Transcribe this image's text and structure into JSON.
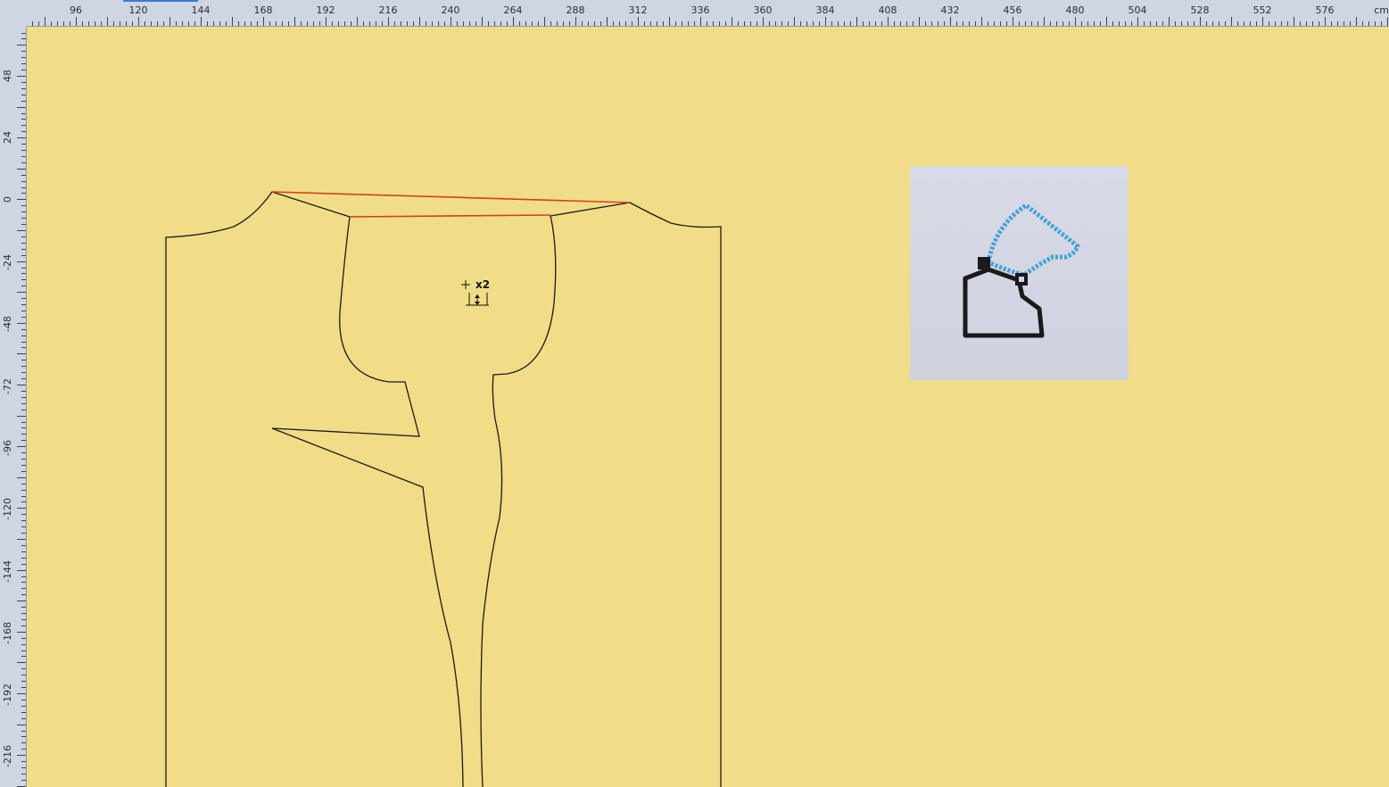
{
  "ruler": {
    "unit": "cm",
    "horizontal_labels": [
      "96",
      "120",
      "144",
      "168",
      "192",
      "216",
      "240",
      "264",
      "288",
      "312",
      "336",
      "360",
      "384",
      "408",
      "432",
      "456",
      "480",
      "504",
      "528",
      "552",
      "576"
    ],
    "vertical_labels": [
      "48",
      "24",
      "0",
      "-24",
      "-48",
      "-72",
      "-96",
      "-120",
      "-144",
      "-168",
      "-192",
      "-216"
    ]
  },
  "cursor": {
    "multiplier": "x2"
  },
  "canvas": {
    "background": "#f1dd87",
    "outline_color": "#1a1a1a",
    "highlight_color": "#d2401e",
    "icon": "adjust-pieces-tool-icon"
  }
}
